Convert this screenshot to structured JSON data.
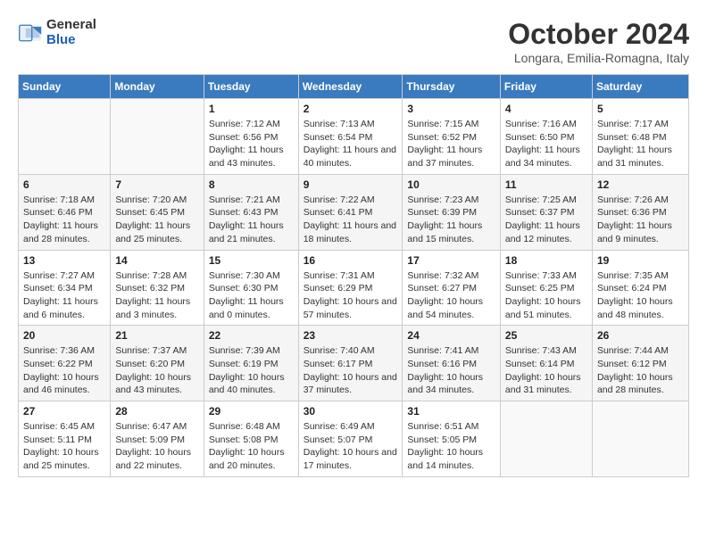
{
  "logo": {
    "general": "General",
    "blue": "Blue"
  },
  "header": {
    "title": "October 2024",
    "subtitle": "Longara, Emilia-Romagna, Italy"
  },
  "weekdays": [
    "Sunday",
    "Monday",
    "Tuesday",
    "Wednesday",
    "Thursday",
    "Friday",
    "Saturday"
  ],
  "weeks": [
    [
      {
        "day": "",
        "sunrise": "",
        "sunset": "",
        "daylight": ""
      },
      {
        "day": "",
        "sunrise": "",
        "sunset": "",
        "daylight": ""
      },
      {
        "day": "1",
        "sunrise": "Sunrise: 7:12 AM",
        "sunset": "Sunset: 6:56 PM",
        "daylight": "Daylight: 11 hours and 43 minutes."
      },
      {
        "day": "2",
        "sunrise": "Sunrise: 7:13 AM",
        "sunset": "Sunset: 6:54 PM",
        "daylight": "Daylight: 11 hours and 40 minutes."
      },
      {
        "day": "3",
        "sunrise": "Sunrise: 7:15 AM",
        "sunset": "Sunset: 6:52 PM",
        "daylight": "Daylight: 11 hours and 37 minutes."
      },
      {
        "day": "4",
        "sunrise": "Sunrise: 7:16 AM",
        "sunset": "Sunset: 6:50 PM",
        "daylight": "Daylight: 11 hours and 34 minutes."
      },
      {
        "day": "5",
        "sunrise": "Sunrise: 7:17 AM",
        "sunset": "Sunset: 6:48 PM",
        "daylight": "Daylight: 11 hours and 31 minutes."
      }
    ],
    [
      {
        "day": "6",
        "sunrise": "Sunrise: 7:18 AM",
        "sunset": "Sunset: 6:46 PM",
        "daylight": "Daylight: 11 hours and 28 minutes."
      },
      {
        "day": "7",
        "sunrise": "Sunrise: 7:20 AM",
        "sunset": "Sunset: 6:45 PM",
        "daylight": "Daylight: 11 hours and 25 minutes."
      },
      {
        "day": "8",
        "sunrise": "Sunrise: 7:21 AM",
        "sunset": "Sunset: 6:43 PM",
        "daylight": "Daylight: 11 hours and 21 minutes."
      },
      {
        "day": "9",
        "sunrise": "Sunrise: 7:22 AM",
        "sunset": "Sunset: 6:41 PM",
        "daylight": "Daylight: 11 hours and 18 minutes."
      },
      {
        "day": "10",
        "sunrise": "Sunrise: 7:23 AM",
        "sunset": "Sunset: 6:39 PM",
        "daylight": "Daylight: 11 hours and 15 minutes."
      },
      {
        "day": "11",
        "sunrise": "Sunrise: 7:25 AM",
        "sunset": "Sunset: 6:37 PM",
        "daylight": "Daylight: 11 hours and 12 minutes."
      },
      {
        "day": "12",
        "sunrise": "Sunrise: 7:26 AM",
        "sunset": "Sunset: 6:36 PM",
        "daylight": "Daylight: 11 hours and 9 minutes."
      }
    ],
    [
      {
        "day": "13",
        "sunrise": "Sunrise: 7:27 AM",
        "sunset": "Sunset: 6:34 PM",
        "daylight": "Daylight: 11 hours and 6 minutes."
      },
      {
        "day": "14",
        "sunrise": "Sunrise: 7:28 AM",
        "sunset": "Sunset: 6:32 PM",
        "daylight": "Daylight: 11 hours and 3 minutes."
      },
      {
        "day": "15",
        "sunrise": "Sunrise: 7:30 AM",
        "sunset": "Sunset: 6:30 PM",
        "daylight": "Daylight: 11 hours and 0 minutes."
      },
      {
        "day": "16",
        "sunrise": "Sunrise: 7:31 AM",
        "sunset": "Sunset: 6:29 PM",
        "daylight": "Daylight: 10 hours and 57 minutes."
      },
      {
        "day": "17",
        "sunrise": "Sunrise: 7:32 AM",
        "sunset": "Sunset: 6:27 PM",
        "daylight": "Daylight: 10 hours and 54 minutes."
      },
      {
        "day": "18",
        "sunrise": "Sunrise: 7:33 AM",
        "sunset": "Sunset: 6:25 PM",
        "daylight": "Daylight: 10 hours and 51 minutes."
      },
      {
        "day": "19",
        "sunrise": "Sunrise: 7:35 AM",
        "sunset": "Sunset: 6:24 PM",
        "daylight": "Daylight: 10 hours and 48 minutes."
      }
    ],
    [
      {
        "day": "20",
        "sunrise": "Sunrise: 7:36 AM",
        "sunset": "Sunset: 6:22 PM",
        "daylight": "Daylight: 10 hours and 46 minutes."
      },
      {
        "day": "21",
        "sunrise": "Sunrise: 7:37 AM",
        "sunset": "Sunset: 6:20 PM",
        "daylight": "Daylight: 10 hours and 43 minutes."
      },
      {
        "day": "22",
        "sunrise": "Sunrise: 7:39 AM",
        "sunset": "Sunset: 6:19 PM",
        "daylight": "Daylight: 10 hours and 40 minutes."
      },
      {
        "day": "23",
        "sunrise": "Sunrise: 7:40 AM",
        "sunset": "Sunset: 6:17 PM",
        "daylight": "Daylight: 10 hours and 37 minutes."
      },
      {
        "day": "24",
        "sunrise": "Sunrise: 7:41 AM",
        "sunset": "Sunset: 6:16 PM",
        "daylight": "Daylight: 10 hours and 34 minutes."
      },
      {
        "day": "25",
        "sunrise": "Sunrise: 7:43 AM",
        "sunset": "Sunset: 6:14 PM",
        "daylight": "Daylight: 10 hours and 31 minutes."
      },
      {
        "day": "26",
        "sunrise": "Sunrise: 7:44 AM",
        "sunset": "Sunset: 6:12 PM",
        "daylight": "Daylight: 10 hours and 28 minutes."
      }
    ],
    [
      {
        "day": "27",
        "sunrise": "Sunrise: 6:45 AM",
        "sunset": "Sunset: 5:11 PM",
        "daylight": "Daylight: 10 hours and 25 minutes."
      },
      {
        "day": "28",
        "sunrise": "Sunrise: 6:47 AM",
        "sunset": "Sunset: 5:09 PM",
        "daylight": "Daylight: 10 hours and 22 minutes."
      },
      {
        "day": "29",
        "sunrise": "Sunrise: 6:48 AM",
        "sunset": "Sunset: 5:08 PM",
        "daylight": "Daylight: 10 hours and 20 minutes."
      },
      {
        "day": "30",
        "sunrise": "Sunrise: 6:49 AM",
        "sunset": "Sunset: 5:07 PM",
        "daylight": "Daylight: 10 hours and 17 minutes."
      },
      {
        "day": "31",
        "sunrise": "Sunrise: 6:51 AM",
        "sunset": "Sunset: 5:05 PM",
        "daylight": "Daylight: 10 hours and 14 minutes."
      },
      {
        "day": "",
        "sunrise": "",
        "sunset": "",
        "daylight": ""
      },
      {
        "day": "",
        "sunrise": "",
        "sunset": "",
        "daylight": ""
      }
    ]
  ]
}
